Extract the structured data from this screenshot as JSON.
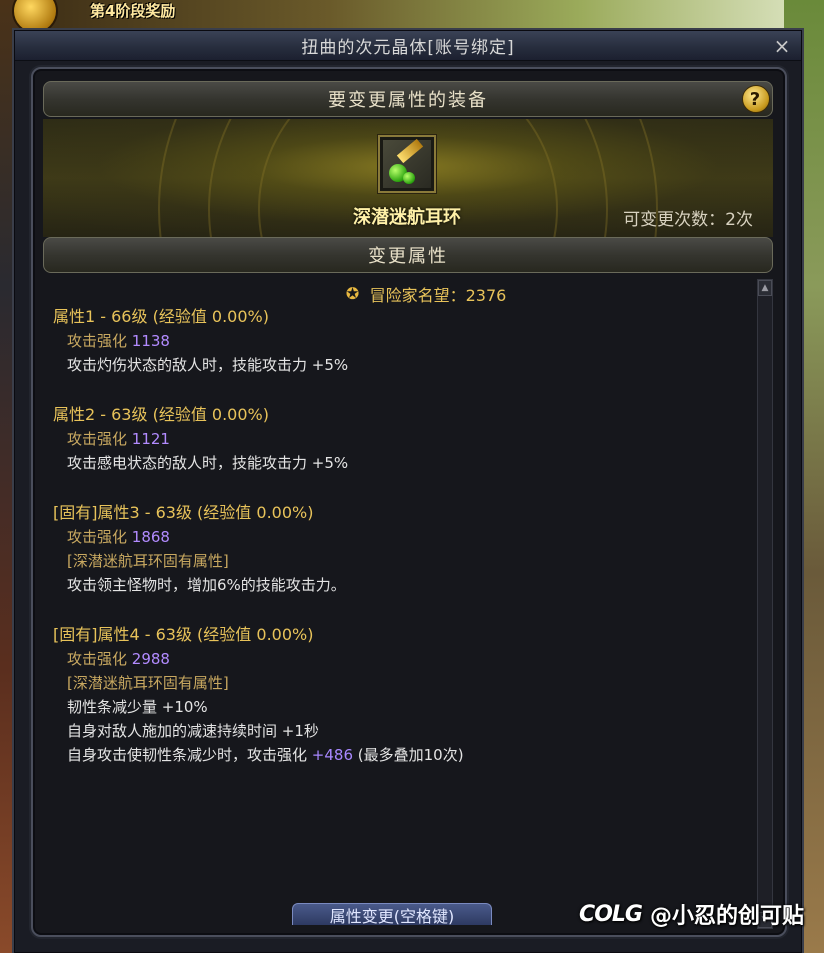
{
  "background": {
    "banner_text": "第4阶段奖励"
  },
  "window": {
    "title": "扭曲的次元晶体[账号绑定]",
    "close_label": "×"
  },
  "equipment_section": {
    "header": "要变更属性的装备",
    "help_label": "?",
    "item_name": "深潜迷航耳环",
    "change_count": "可变更次数：2次"
  },
  "attributes_section": {
    "header": "变更属性",
    "fame": "冒险家名望：2376",
    "blocks": [
      {
        "title": "属性1 - 66级 (经验值 0.00%)",
        "stat_label": "攻击强化",
        "stat_value": "1138",
        "lines": [
          "攻击灼伤状态的敌人时，技能攻击力 +5%"
        ]
      },
      {
        "title": "属性2 - 63级 (经验值 0.00%)",
        "stat_label": "攻击强化",
        "stat_value": "1121",
        "lines": [
          "攻击感电状态的敌人时，技能攻击力 +5%"
        ]
      },
      {
        "title": "[固有]属性3 - 63级 (经验值 0.00%)",
        "stat_label": "攻击强化",
        "stat_value": "1868",
        "fixed_label": "[深潜迷航耳环固有属性]",
        "lines": [
          "攻击领主怪物时，增加6%的技能攻击力。"
        ]
      },
      {
        "title": "[固有]属性4 - 63级 (经验值 0.00%)",
        "stat_label": "攻击强化",
        "stat_value": "2988",
        "fixed_label": "[深潜迷航耳环固有属性]",
        "lines": [
          "韧性条减少量 +10%",
          "自身对敌人施加的减速持续时间 +1秒"
        ],
        "last_line_prefix": "自身攻击使韧性条减少时，攻击强化",
        "last_line_value": "+486",
        "last_line_suffix": "(最多叠加10次)"
      }
    ]
  },
  "bottom_button": "属性变更(空格键)",
  "watermark": {
    "logo": "COLG",
    "text": "@小忍的创可贴"
  }
}
